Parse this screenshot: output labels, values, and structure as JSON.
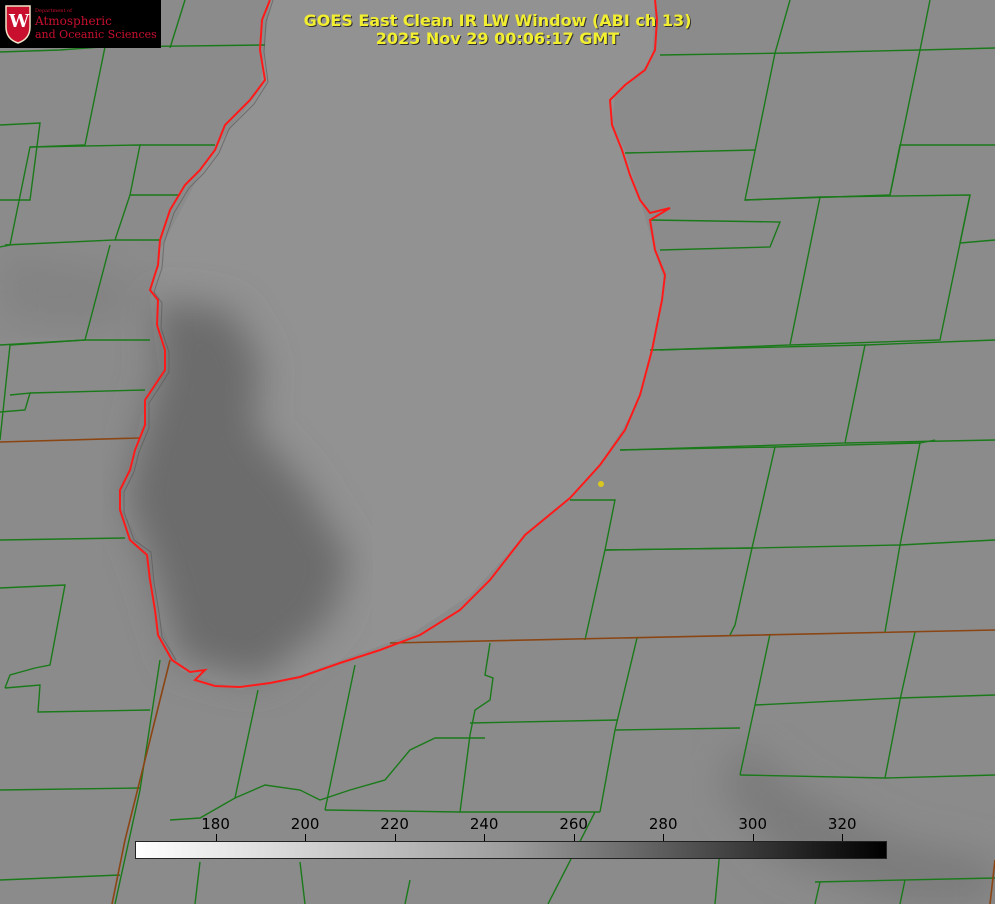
{
  "title": {
    "line1": "GOES East Clean IR LW Window (ABI ch 13)",
    "line2": "2025 Nov 29 00:06:17 GMT"
  },
  "logo": {
    "dept": "Department of",
    "line1": "Atmospheric",
    "line2": "and Oceanic Sciences",
    "crest_letter": "W"
  },
  "colorbar": {
    "ticks": [
      "180",
      "200",
      "220",
      "240",
      "260",
      "280",
      "300",
      "320"
    ],
    "range": [
      162,
      330
    ],
    "gradient": [
      "#ffffff",
      "#000000"
    ]
  },
  "colors": {
    "background": "#8a8a8a",
    "county_lines": "#1a7a1a",
    "state_lines": "#8b4513",
    "coastline": "#ff2020",
    "title_text": "#f2ee30",
    "logo_text": "#c8102e",
    "marker": "#d8c820"
  }
}
